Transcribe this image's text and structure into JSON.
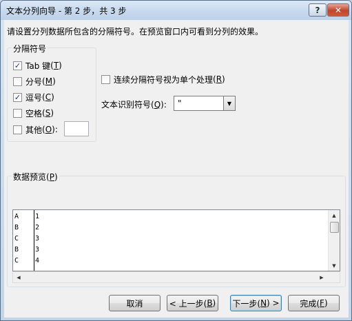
{
  "window": {
    "title": "文本分列向导 - 第 2 步，共 3 步",
    "help_label": "?",
    "close_label": "✕"
  },
  "instruction": "请设置分列数据所包含的分隔符号。在预览窗口内可看到分列的效果。",
  "delimiters": {
    "label": "分隔符号",
    "options": [
      {
        "text": "Tab 键",
        "hotkey": "T",
        "checked": true,
        "check": "✓"
      },
      {
        "text": "分号",
        "hotkey": "M",
        "checked": false,
        "check": ""
      },
      {
        "text": "逗号",
        "hotkey": "C",
        "checked": true,
        "check": "✓"
      },
      {
        "text": "空格",
        "hotkey": "S",
        "checked": false,
        "check": ""
      },
      {
        "text": "其他",
        "hotkey": "O",
        "checked": false,
        "check": "",
        "suffix": ":"
      }
    ],
    "other_value": ""
  },
  "consecutive": {
    "text": "连续分隔符号视为单个处理",
    "hotkey": "R",
    "checked": false
  },
  "qualifier": {
    "label": "文本识别符号",
    "hotkey": "Q",
    "suffix": ":",
    "value": "\""
  },
  "preview": {
    "label": "数据预览",
    "hotkey": "P",
    "rows": [
      {
        "a": "A",
        "b": "1"
      },
      {
        "a": "B",
        "b": "2"
      },
      {
        "a": "C",
        "b": "3"
      },
      {
        "a": "B",
        "b": "3"
      },
      {
        "a": "C",
        "b": "4"
      }
    ]
  },
  "buttons": {
    "cancel": "取消",
    "back": {
      "prefix": "< 上一步(",
      "hotkey": "B",
      "suffix": ")"
    },
    "next": {
      "prefix": "下一步(",
      "hotkey": "N",
      "suffix": ") >"
    },
    "finish": {
      "prefix": "完成(",
      "hotkey": "F",
      "suffix": ")"
    }
  }
}
